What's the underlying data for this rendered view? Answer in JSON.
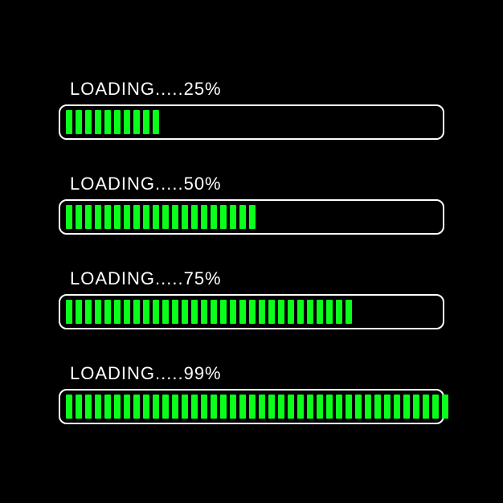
{
  "bars": [
    {
      "label": "LOADING.....25%",
      "segments": 10,
      "total": 40
    },
    {
      "label": "LOADING.....50%",
      "segments": 20,
      "total": 40
    },
    {
      "label": "LOADING.....75%",
      "segments": 30,
      "total": 40
    },
    {
      "label": "LOADING.....99%",
      "segments": 40,
      "total": 40
    }
  ],
  "colors": {
    "background": "#000000",
    "text": "#ffffff",
    "fill": "#0aff1a",
    "border": "#ffffff"
  }
}
